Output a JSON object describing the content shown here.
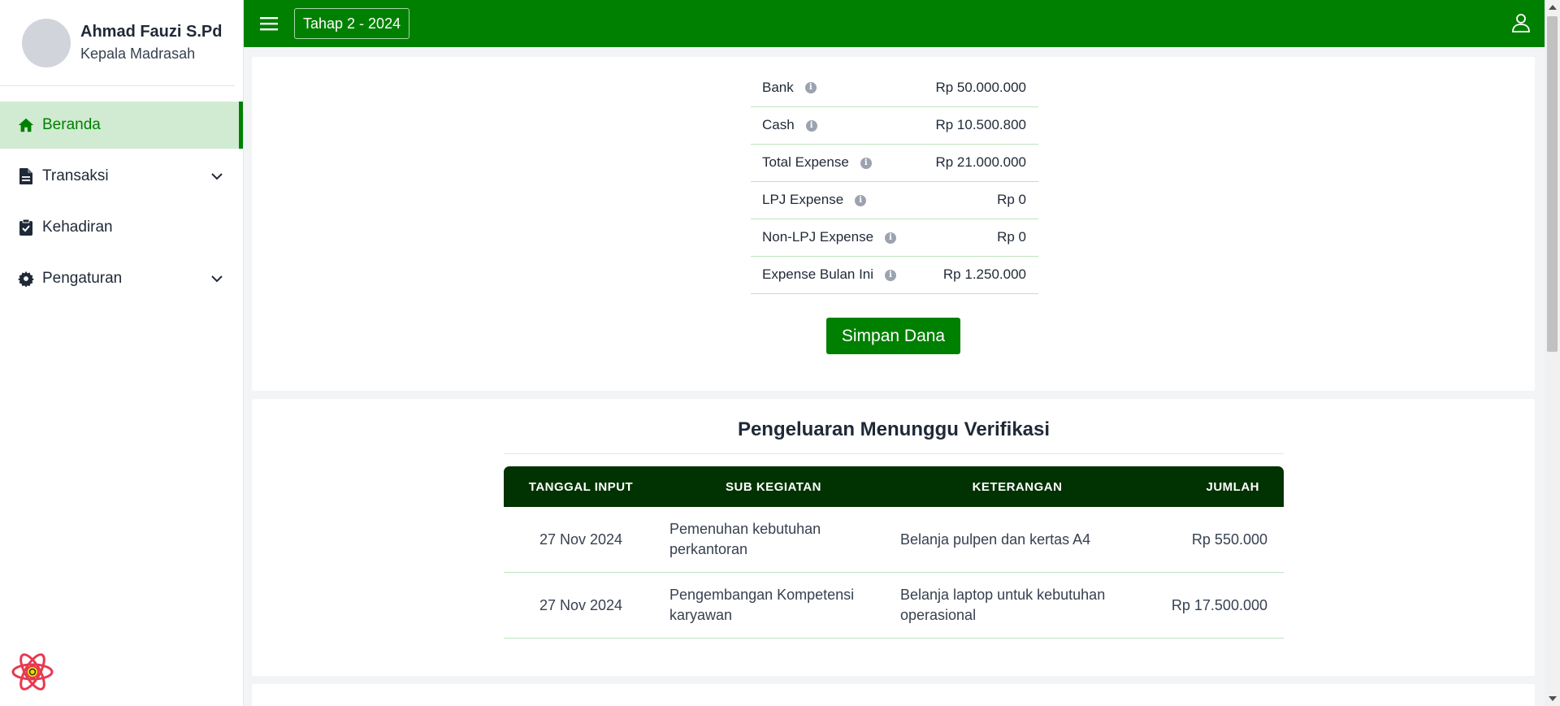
{
  "profile": {
    "name": "Ahmad Fauzi S.Pd",
    "role": "Kepala Madrasah"
  },
  "sidebar": {
    "items": [
      {
        "label": "Beranda",
        "icon": "home-icon",
        "active": true
      },
      {
        "label": "Transaksi",
        "icon": "document-icon",
        "expandable": true
      },
      {
        "label": "Kehadiran",
        "icon": "clipboard-check-icon"
      },
      {
        "label": "Pengaturan",
        "icon": "gear-icon",
        "expandable": true
      }
    ]
  },
  "topbar": {
    "period": "Tahap 2 - 2024"
  },
  "summary": {
    "rows": [
      {
        "label": "Bank",
        "value": "Rp 50.000.000"
      },
      {
        "label": "Cash",
        "value": "Rp 10.500.800"
      },
      {
        "label": "Total Expense",
        "value": "Rp 21.000.000"
      },
      {
        "label": "LPJ Expense",
        "value": "Rp 0"
      },
      {
        "label": "Non-LPJ Expense",
        "value": "Rp 0"
      },
      {
        "label": "Expense Bulan Ini",
        "value": "Rp 1.250.000"
      }
    ],
    "save_label": "Simpan Dana"
  },
  "pending": {
    "title": "Pengeluaran Menunggu Verifikasi",
    "columns": [
      "TANGGAL INPUT",
      "SUB KEGIATAN",
      "KETERANGAN",
      "JUMLAH"
    ],
    "rows": [
      [
        "27 Nov 2024",
        "Pemenuhan kebutuhan perkantoran",
        "Belanja pulpen dan kertas A4",
        "Rp 550.000"
      ],
      [
        "27 Nov 2024",
        "Pengembangan Kompetensi karyawan",
        "Belanja laptop untuk kebutuhan operasional",
        "Rp 17.500.000"
      ]
    ]
  },
  "colors": {
    "primary": "#008000",
    "table_header": "#013201",
    "active_bg": "#d1ebd2"
  }
}
